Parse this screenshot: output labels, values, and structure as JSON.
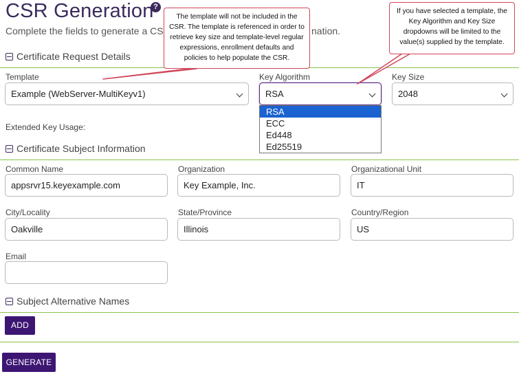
{
  "page": {
    "title": "CSR Generation",
    "help_icon_glyph": "?",
    "subtitle_start": "Complete the fields to generate a CS",
    "subtitle_end": "nation."
  },
  "sections": {
    "request_details": "Certificate Request Details",
    "subject_info": "Certificate Subject Information",
    "san": "Subject Alternative Names"
  },
  "request": {
    "template_label": "Template",
    "template_value": "Example (WebServer-MultiKeyv1)",
    "key_algorithm_label": "Key Algorithm",
    "key_algorithm_value": "RSA",
    "key_size_label": "Key Size",
    "key_size_value": "2048",
    "extended_key_usage_label": "Extended Key Usage:",
    "key_algorithm_options": [
      "RSA",
      "ECC",
      "Ed448",
      "Ed25519"
    ]
  },
  "subject": {
    "common_name_label": "Common Name",
    "common_name_value": "appsrvr15.keyexample.com",
    "organization_label": "Organization",
    "organization_value": "Key Example, Inc.",
    "org_unit_label": "Organizational Unit",
    "org_unit_value": "IT",
    "city_label": "City/Locality",
    "city_value": "Oakville",
    "state_label": "State/Province",
    "state_value": "Illinois",
    "country_label": "Country/Region",
    "country_value": "US",
    "email_label": "Email",
    "email_value": ""
  },
  "buttons": {
    "add": "ADD",
    "generate": "GENERATE"
  },
  "callouts": {
    "template_note": "The template will not be included in the CSR. The template is referenced in order to retrieve key size and template-level regular expressions, enrollment defaults and policies  to help populate the CSR.",
    "key_note": "If you have selected a template, the Key Algorithm and Key Size dropdowns will be limited to the value(s) supplied by the template."
  },
  "colors": {
    "brand_purple": "#3d1673",
    "title_purple": "#3b2a5c",
    "divider_green": "#8bc34a",
    "callout_red": "#d0455a",
    "selected_option_blue": "#1a63d0"
  }
}
